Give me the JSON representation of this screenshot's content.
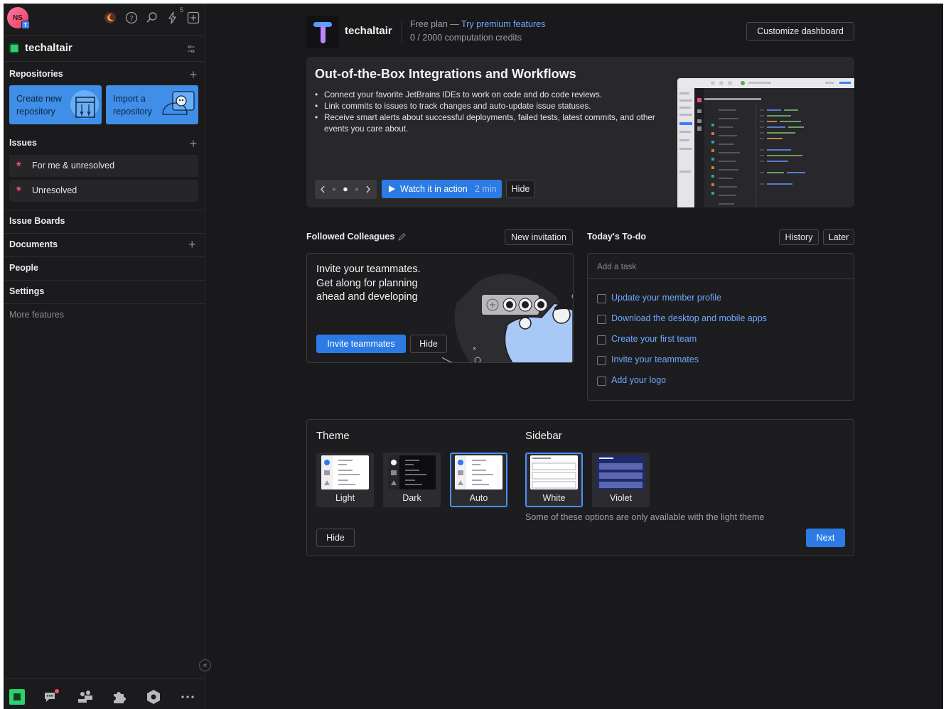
{
  "sidebar": {
    "avatar_initials": "NS",
    "avatar_org_badge": "T",
    "notification_count": "5",
    "org_name": "techaltair",
    "repositories": {
      "title": "Repositories",
      "create_label": "Create new repository",
      "import_label": "Import a repository"
    },
    "issues": {
      "title": "Issues",
      "items": [
        {
          "label": "For me & unresolved"
        },
        {
          "label": "Unresolved"
        }
      ]
    },
    "nav": {
      "issue_boards": "Issue Boards",
      "documents": "Documents",
      "people": "People",
      "settings": "Settings",
      "more_features": "More features"
    },
    "bottom_icons": [
      "home-icon",
      "chats-icon",
      "teams-icon",
      "extensions-icon",
      "settings-hexagon-icon",
      "more-icon"
    ]
  },
  "header": {
    "org_name": "techaltair",
    "plan_text": "Free plan — ",
    "premium_link": "Try premium features",
    "credits": "0 / 2000 computation credits",
    "customize_button": "Customize dashboard"
  },
  "promo": {
    "title": "Out-of-the-Box Integrations and Workflows",
    "bullets": [
      "Connect your favorite JetBrains IDEs to work on code and do code reviews.",
      "Link commits to issues to track changes and auto-update issue statuses.",
      "Receive smart alerts about successful deployments, failed tests, latest commits, and other events you care about."
    ],
    "watch_label": "Watch it in action",
    "watch_duration": "2 min",
    "hide_label": "Hide",
    "pager_active_index": 1
  },
  "colleagues": {
    "title": "Followed Colleagues",
    "new_invitation": "New invitation",
    "invite_line1": "Invite your teammates.",
    "invite_line2": "Get along for planning",
    "invite_line3": "ahead and developing",
    "invite_button": "Invite teammates",
    "hide_button": "Hide"
  },
  "todo": {
    "title": "Today's To-do",
    "history": "History",
    "later": "Later",
    "placeholder": "Add a task",
    "items": [
      {
        "label": "Update your member profile",
        "checked": false
      },
      {
        "label": "Download the desktop and mobile apps",
        "checked": false
      },
      {
        "label": "Create your first team",
        "checked": false
      },
      {
        "label": "Invite your teammates",
        "checked": false
      },
      {
        "label": "Add your logo",
        "checked": false
      }
    ]
  },
  "appearance": {
    "theme_title": "Theme",
    "sidebar_title": "Sidebar",
    "themes": [
      {
        "label": "Light",
        "selected": false
      },
      {
        "label": "Dark",
        "selected": false
      },
      {
        "label": "Auto",
        "selected": true
      }
    ],
    "sidebar_options": [
      {
        "label": "White",
        "selected": true
      },
      {
        "label": "Violet",
        "selected": false
      }
    ],
    "note": "Some of these options are only available with the light theme",
    "hide": "Hide",
    "next": "Next"
  },
  "colors": {
    "background": "#19191b",
    "accent_blue": "#2c7be5",
    "link_blue": "#6fa8ff",
    "issue_star": "#ff4f6b",
    "org_green": "#2fd06f"
  }
}
